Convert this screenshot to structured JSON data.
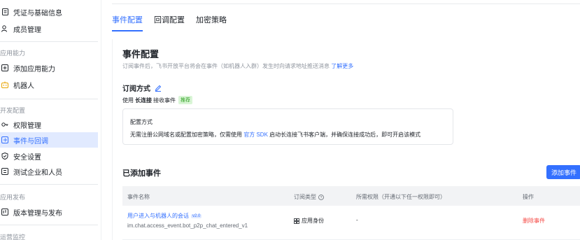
{
  "sidebar": {
    "item_credentials": "凭证与基础信息",
    "item_members": "成员管理",
    "section_app_capability": "应用能力",
    "item_add_capability": "添加应用能力",
    "item_bot": "机器人",
    "section_dev_config": "开发配置",
    "item_permissions": "权限管理",
    "item_events": "事件与回调",
    "item_security": "安全设置",
    "item_test_org": "测试企业和人员",
    "section_app_release": "应用发布",
    "item_versions": "版本管理与发布",
    "section_ops": "运营监控"
  },
  "tabs": {
    "events": "事件配置",
    "callbacks": "回调配置",
    "encryption": "加密策略"
  },
  "main": {
    "title": "事件配置",
    "description": "订阅事件后，飞书开放平台将会在事件（如机器人入群）发生时向请求地址推送消息",
    "learn_more": "了解更多",
    "subscribe_title": "订阅方式",
    "usage_prefix": "使用",
    "usage_mode": "长连接",
    "usage_suffix": "接收事件",
    "recommended_tag": "推荐",
    "config_box_title": "配置方式",
    "config_box_text_before": "无需注册公网域名或配置加密策略，仅需使用",
    "config_box_link": "官方 SDK",
    "config_box_text_after": "启动长连接飞书客户端，并确保连接成功后，即可开启该模式",
    "added_events_title": "已添加事件",
    "add_event_button": "添加事件"
  },
  "table": {
    "headers": {
      "name": "事件名称",
      "type": "订阅类型",
      "permission": "所需权限（开通以下任一权限即可）",
      "action": "操作"
    },
    "rows": [
      {
        "name": "用户进入与机器人的会话",
        "version": "v2.0",
        "event_id": "im.chat.access_event.bot_p2p_chat_entered_v1",
        "type": "应用身份",
        "permission": "-",
        "action": "删除事件"
      }
    ]
  },
  "colors": {
    "accent": "#3370ff",
    "danger": "#f54a45",
    "active_bg": "#e1eaff",
    "tag_green": "#2ea121"
  }
}
